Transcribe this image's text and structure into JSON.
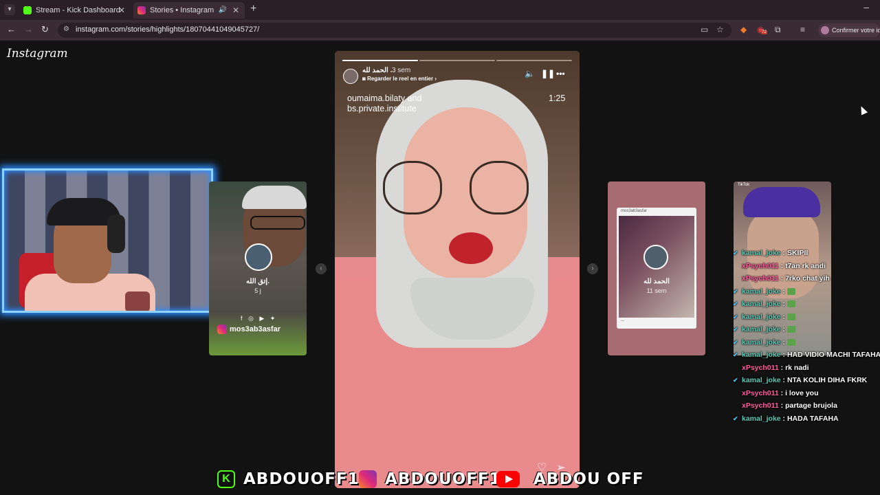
{
  "browser": {
    "tabs": [
      {
        "title": "Stream - Kick Dashboard",
        "favicon": "kick-icon",
        "active": false
      },
      {
        "title": "Stories • Instagram",
        "favicon": "instagram-icon",
        "active": true
      }
    ],
    "url": "instagram.com/stories/highlights/18070441049045727/",
    "profile_label": "Confirmer votre ide",
    "extension_badge": "72"
  },
  "instagram": {
    "logo_text": "Instagram"
  },
  "main_story": {
    "username": "الحمد لله .",
    "time": "3 sem",
    "reel_link": "Regarder le reel en entier",
    "collab_line1": "oumaima.bilaty and",
    "collab_line2": "bs.private.institute",
    "duration": "1:25",
    "progress": [
      1.0,
      0.0,
      0.0
    ]
  },
  "left_card": {
    "name": "إتق الله.",
    "time": "5 j",
    "brand": "mos3ab3asfar"
  },
  "mid_card": {
    "name": "الحمد لله",
    "time": "11 sem",
    "post_user": "mos3ab3asfar"
  },
  "right_card": {
    "brand": "TikTok"
  },
  "chat": [
    {
      "user": "kamal_joke",
      "color": "#5ecbb8",
      "verified": true,
      "text": "SKIPII"
    },
    {
      "user": "xPsych011",
      "color": "#ff5fa2",
      "verified": false,
      "text": "t7an rk andi"
    },
    {
      "user": "xPsych011",
      "color": "#ff5fa2",
      "verified": false,
      "text": "7rko chat yih"
    },
    {
      "user": "kamal_joke",
      "color": "#5ecbb8",
      "verified": true,
      "text": ""
    },
    {
      "user": "kamal_joke",
      "color": "#5ecbb8",
      "verified": true,
      "text": ""
    },
    {
      "user": "kamal_joke",
      "color": "#5ecbb8",
      "verified": true,
      "text": ""
    },
    {
      "user": "kamal_joke",
      "color": "#5ecbb8",
      "verified": true,
      "text": ""
    },
    {
      "user": "kamal_joke",
      "color": "#5ecbb8",
      "verified": true,
      "text": ""
    },
    {
      "user": "kamal_joke",
      "color": "#5ecbb8",
      "verified": true,
      "text": "HAD VIDIO MACHI TAFAHA"
    },
    {
      "user": "xPsych011",
      "color": "#ff5fa2",
      "verified": false,
      "text": "rk nadi"
    },
    {
      "user": "kamal_joke",
      "color": "#5ecbb8",
      "verified": true,
      "text": "NTA KOLIH DIHA FKRK"
    },
    {
      "user": "xPsych011",
      "color": "#ff5fa2",
      "verified": false,
      "text": "i love you"
    },
    {
      "user": "xPsych011",
      "color": "#ff5fa2",
      "verified": false,
      "text": "partage brujola"
    },
    {
      "user": "kamal_joke",
      "color": "#5ecbb8",
      "verified": true,
      "text": "HADA TAFAHA"
    }
  ],
  "footer": {
    "kick_handle": "ABDOUOFF1",
    "instagram_handle": "ABDOUOFF1",
    "youtube_handle": "ABDOU OFF",
    "kick_letter": "K"
  },
  "colors": {
    "kick_green": "#53fc18",
    "webcam_glow": "#2b8cff",
    "instagram_gradient": [
      "#f58529",
      "#dd2a7b",
      "#8134af"
    ]
  }
}
